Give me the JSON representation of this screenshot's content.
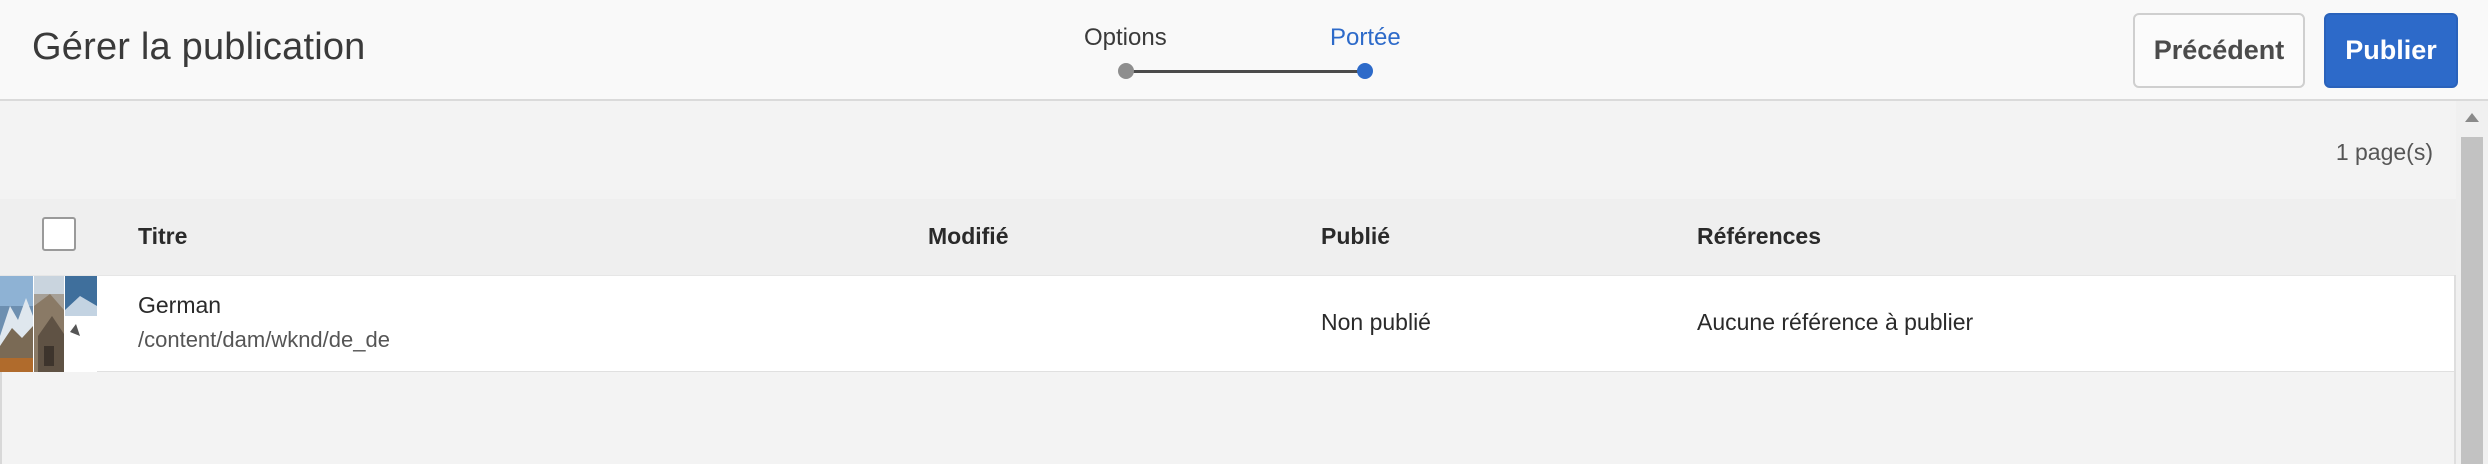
{
  "header": {
    "title": "Gérer la publication",
    "steps": [
      {
        "label": "Options",
        "state": "completed",
        "color": "#8e8e8e"
      },
      {
        "label": "Portée",
        "state": "current",
        "color": "#2d6ac9"
      }
    ],
    "buttons": {
      "previous_label": "Précédent",
      "publish_label": "Publier"
    }
  },
  "content": {
    "page_count": "1 page(s)",
    "table": {
      "columns": [
        "Titre",
        "Modifié",
        "Publié",
        "Références"
      ],
      "rows": [
        {
          "title": "German",
          "path": "/content/dam/wknd/de_de",
          "modified": "",
          "published": "Non publié",
          "references": "Aucune référence à publier",
          "thumbnail_icon": "folder-collage-thumbnail"
        }
      ]
    }
  },
  "colors": {
    "accent": "#2d6ac9",
    "header_bg": "#f9f9f9",
    "content_bg": "#f3f3f3"
  }
}
